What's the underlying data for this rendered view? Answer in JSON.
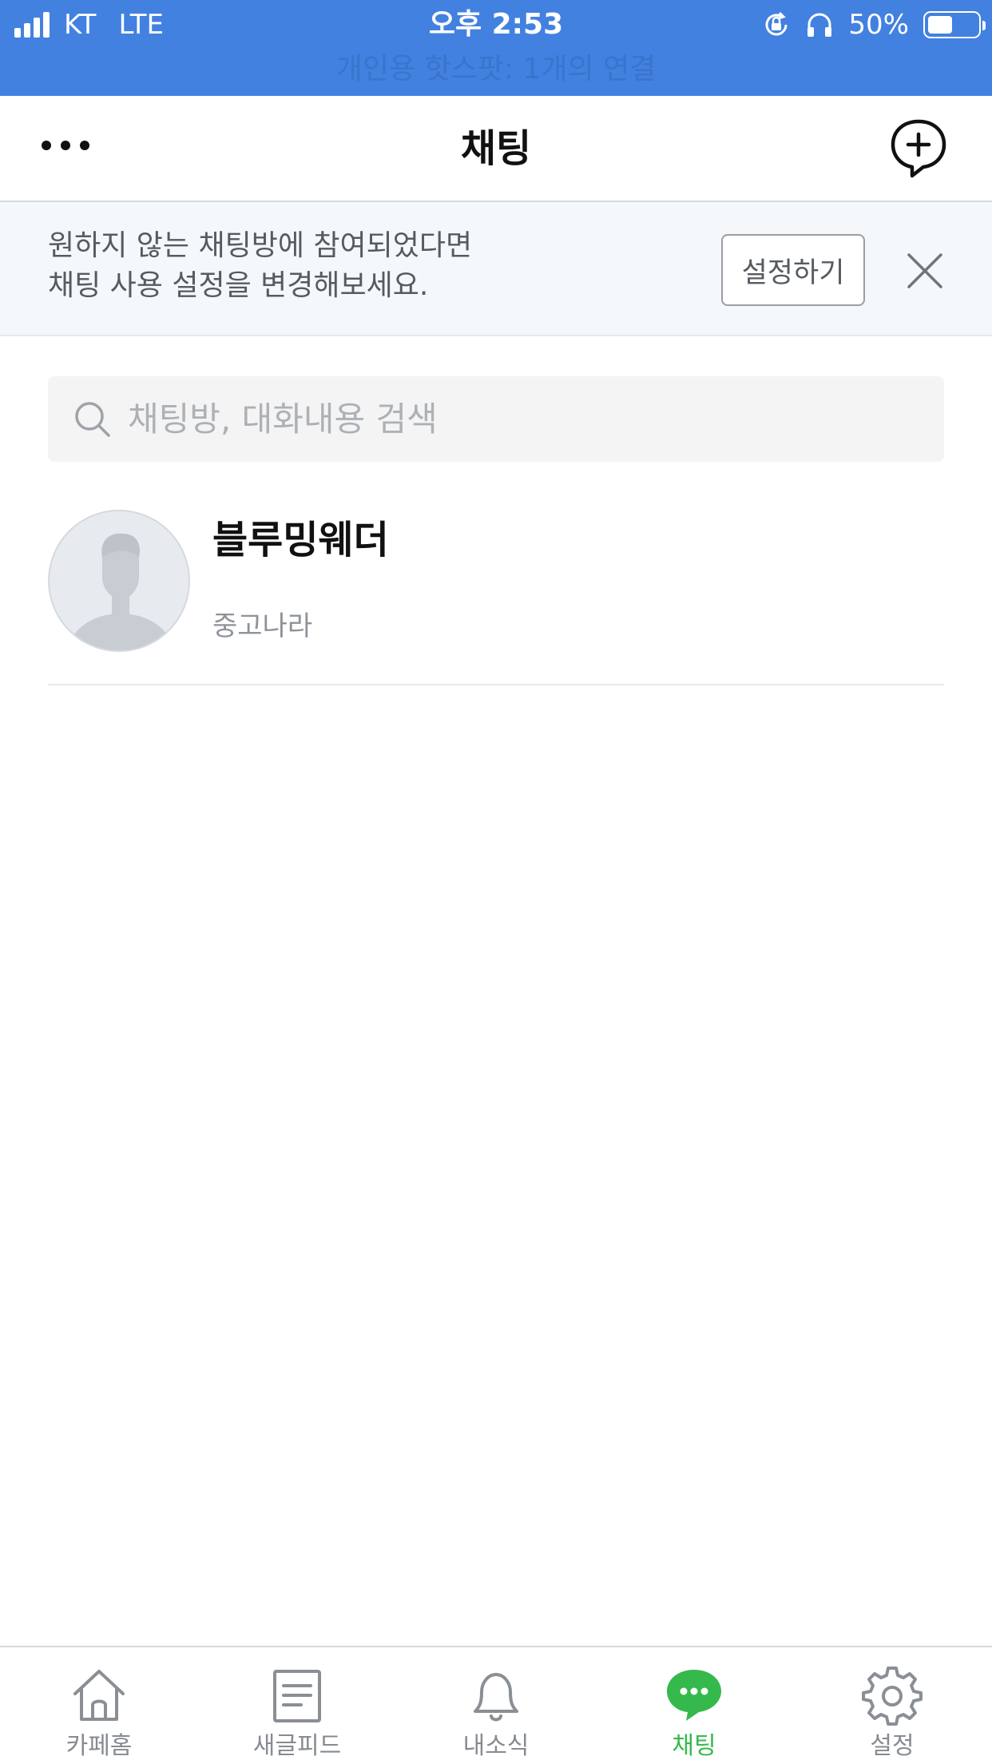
{
  "status_bar": {
    "carrier": "KT",
    "network": "LTE",
    "time": "오후 2:53",
    "battery": "50%",
    "battery_level": 0.5,
    "hotspot": "개인용 핫스팟: 1개의 연결",
    "icons": [
      "signal-icon",
      "rotation-lock-icon",
      "headphones-icon",
      "battery-icon"
    ]
  },
  "nav": {
    "title": "채팅",
    "left_icon": "more-icon",
    "right_icon": "new-chat-icon"
  },
  "banner": {
    "line1": "원하지 않는 채팅방에 참여되었다면",
    "line2": "채팅 사용 설정을 변경해보세요.",
    "button_label": "설정하기",
    "close_icon": "close-icon"
  },
  "search": {
    "placeholder": "채팅방, 대화내용 검색",
    "value": ""
  },
  "chats": [
    {
      "name": "블루밍웨더",
      "subtitle": "중고나라",
      "avatar": "default-avatar"
    }
  ],
  "tabs": [
    {
      "label": "카페홈",
      "icon": "home-icon",
      "active": false
    },
    {
      "label": "새글피드",
      "icon": "feed-icon",
      "active": false
    },
    {
      "label": "내소식",
      "icon": "bell-icon",
      "active": false
    },
    {
      "label": "채팅",
      "icon": "chat-icon",
      "active": true
    },
    {
      "label": "설정",
      "icon": "gear-icon",
      "active": false
    }
  ],
  "colors": {
    "status_bar": "#4281e0",
    "active_tab": "#36b94c",
    "inactive_tab": "#868b91",
    "banner_bg": "#f5f8fb"
  }
}
